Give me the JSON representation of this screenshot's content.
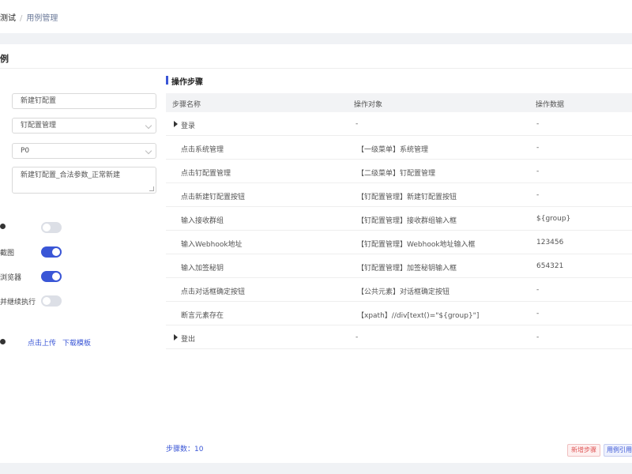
{
  "breadcrumb": {
    "current": "测试",
    "separator": "/",
    "link": "用例管理"
  },
  "card": {
    "title": "例"
  },
  "form": {
    "name_value": "新建钉配置",
    "module_value": "钉配置管理",
    "priority_value": "P0",
    "description_value": "新建钉配置_合法参数_正常新建",
    "toggle1": {
      "on": false
    },
    "toggle2": {
      "label": "截图",
      "on": true
    },
    "toggle3": {
      "label": "浏览器",
      "on": true
    },
    "toggle4": {
      "label": "并继续执行",
      "on": false
    },
    "upload_label": "点击上传",
    "download_label": "下载模板"
  },
  "steps_section": {
    "title": "操作步骤"
  },
  "table": {
    "headers": {
      "step_name": "步骤名称",
      "target": "操作对象",
      "data": "操作数据"
    },
    "rows": [
      {
        "name": "登录",
        "target": "-",
        "data": "-",
        "expandable": true
      },
      {
        "name": "点击系统管理",
        "target": "【一级菜单】系统管理",
        "data": "-"
      },
      {
        "name": "点击钉配置管理",
        "target": "【二级菜单】钉配置管理",
        "data": "-"
      },
      {
        "name": "点击新建钉配置按钮",
        "target": "【钉配置管理】新建钉配置按钮",
        "data": "-"
      },
      {
        "name": "输入接收群组",
        "target": "【钉配置管理】接收群组输入框",
        "data": "${group}"
      },
      {
        "name": "输入Webhook地址",
        "target": "【钉配置管理】Webhook地址输入框",
        "data": "123456"
      },
      {
        "name": "输入加签秘钥",
        "target": "【钉配置管理】加签秘钥输入框",
        "data": "654321"
      },
      {
        "name": "点击对话框确定按钮",
        "target": "【公共元素】对话框确定按钮",
        "data": "-"
      },
      {
        "name": "断言元素存在",
        "target": "【xpath】//div[text()=\"${group}\"]",
        "data": "-"
      },
      {
        "name": "登出",
        "target": "-",
        "data": "-",
        "expandable": true
      }
    ]
  },
  "footer": {
    "step_count": "步骤数：10",
    "add_step_label": "新增步骤",
    "reference_label": "用例引用"
  }
}
